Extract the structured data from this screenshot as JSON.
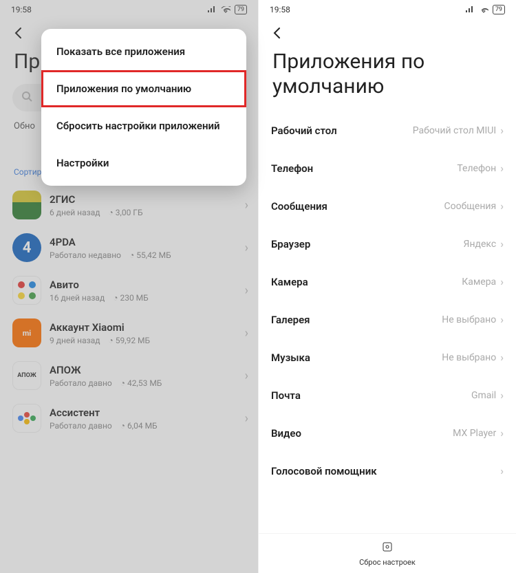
{
  "status": {
    "time": "19:58",
    "battery": "79"
  },
  "left": {
    "title_partial": "Пр",
    "sub_truncated": "Обно",
    "sort_label": "Сортировка по имени приложения",
    "apps": [
      {
        "name": "2ГИС",
        "subtitle": "6 дней назад",
        "size": "3,00 ГБ"
      },
      {
        "name": "4PDA",
        "subtitle": "Работало недавно",
        "size": "55,42 МБ"
      },
      {
        "name": "Авито",
        "subtitle": "16 дней назад",
        "size": "230 МБ"
      },
      {
        "name": "Аккаунт Xiaomi",
        "subtitle": "9 дней назад",
        "size": "59,92 МБ"
      },
      {
        "name": "АПОЖ",
        "subtitle": "Работало давно",
        "size": "42,53 МБ"
      },
      {
        "name": "Ассистент",
        "subtitle": "Работало давно",
        "size": "6,04 МБ"
      }
    ],
    "popup": [
      "Показать все приложения",
      "Приложения по умолчанию",
      "Сбросить настройки приложений",
      "Настройки"
    ]
  },
  "right": {
    "title": "Приложения по умолчанию",
    "rows": [
      {
        "label": "Рабочий стол",
        "value": "Рабочий стол MIUI"
      },
      {
        "label": "Телефон",
        "value": "Телефон"
      },
      {
        "label": "Сообщения",
        "value": "Сообщения"
      },
      {
        "label": "Браузер",
        "value": "Яндекс"
      },
      {
        "label": "Камера",
        "value": "Камера"
      },
      {
        "label": "Галерея",
        "value": "Не выбрано"
      },
      {
        "label": "Музыка",
        "value": "Не выбрано"
      },
      {
        "label": "Почта",
        "value": "Gmail"
      },
      {
        "label": "Видео",
        "value": "MX Player"
      },
      {
        "label": "Голосовой помощник",
        "value": ""
      }
    ],
    "reset_label": "Сброс настроек"
  }
}
